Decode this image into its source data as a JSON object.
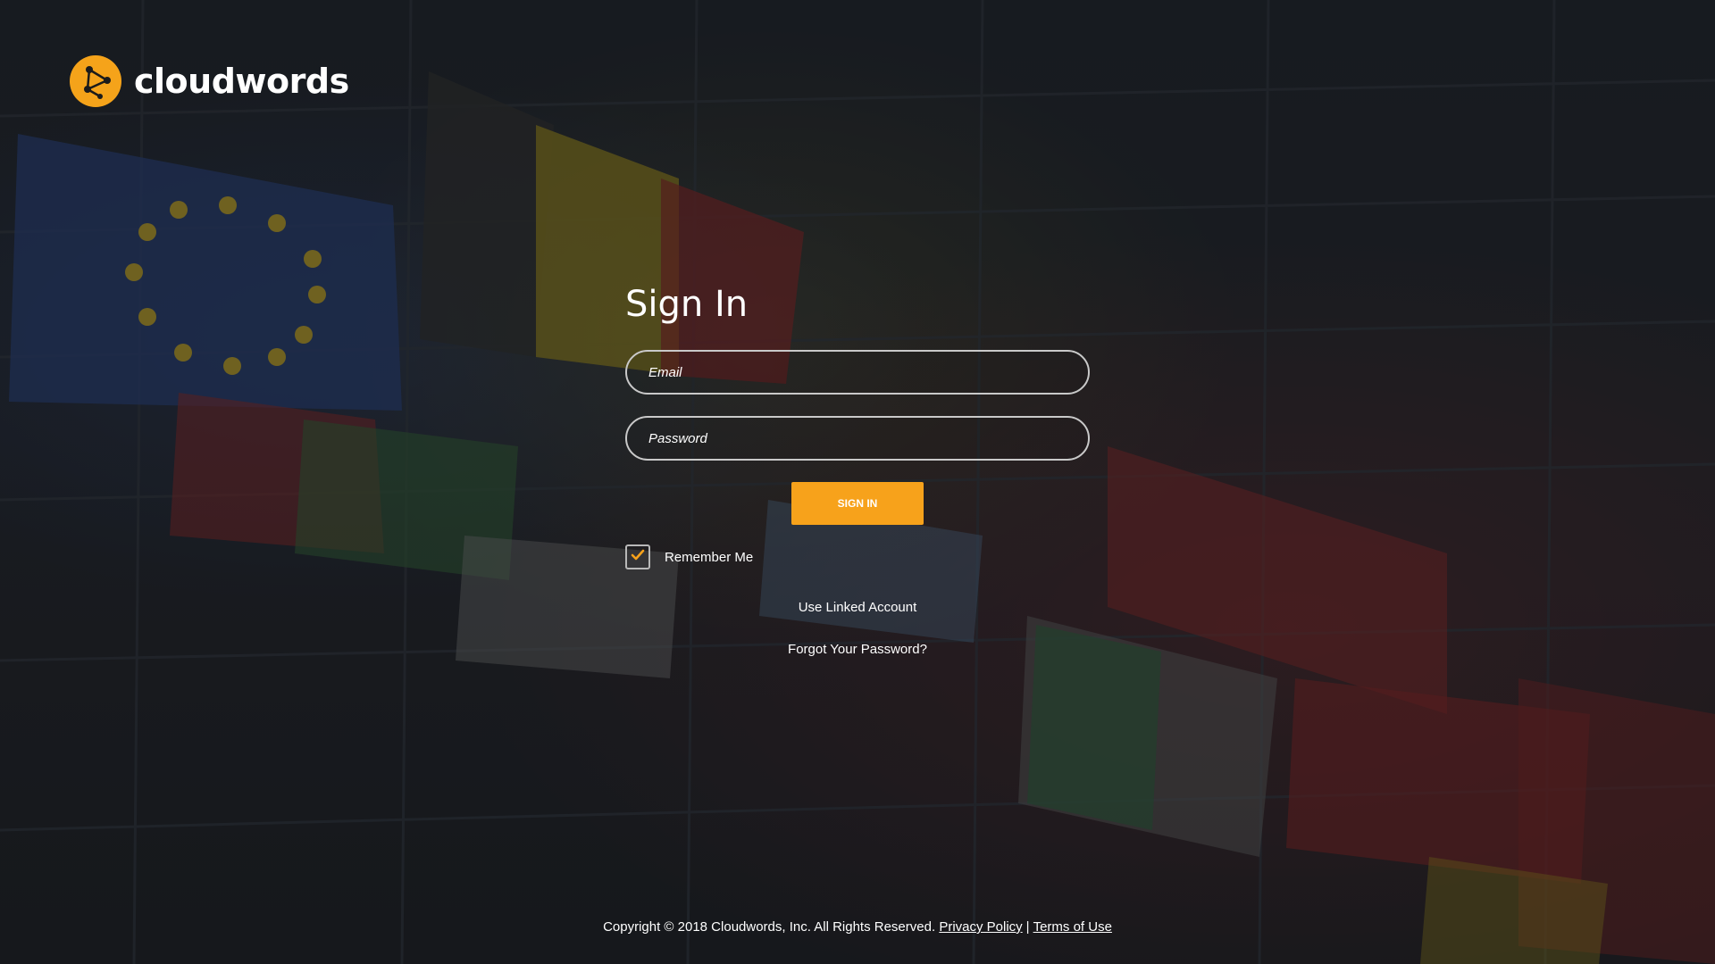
{
  "brand": {
    "name": "cloudwords",
    "accent_color": "#f7a21b"
  },
  "form": {
    "title": "Sign In",
    "email_placeholder": "Email",
    "password_placeholder": "Password",
    "submit_label": "SIGN IN",
    "remember_label": "Remember Me",
    "remember_checked": true,
    "linked_account_label": "Use Linked Account",
    "forgot_password_label": "Forgot Your Password?"
  },
  "footer": {
    "copyright": "Copyright © 2018 Cloudwords, Inc. All Rights Reserved.",
    "privacy_label": "Privacy Policy",
    "separator": "|",
    "terms_label": "Terms of Use"
  },
  "background": {
    "description_icon": "flags-photo"
  }
}
